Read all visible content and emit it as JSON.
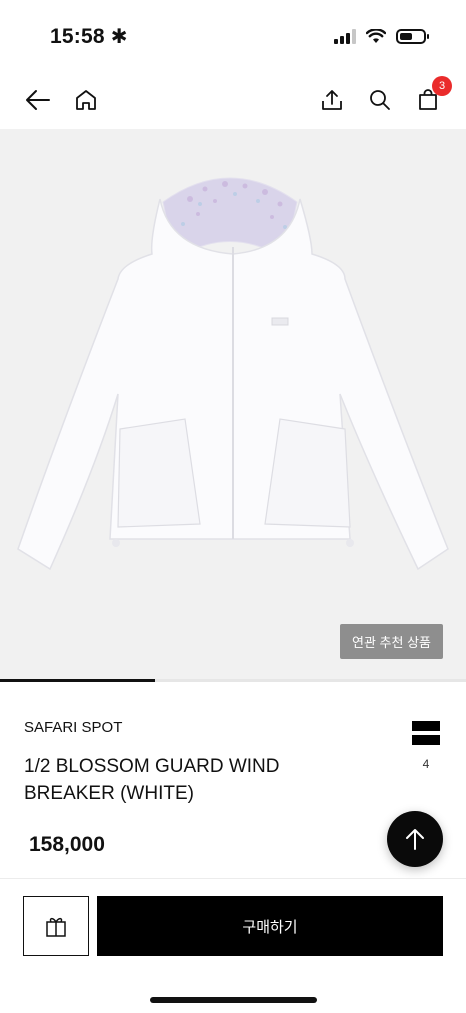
{
  "status_bar": {
    "time": "15:58",
    "time_suffix_icon": "asterisk-icon"
  },
  "nav": {
    "back_icon": "arrow-left-icon",
    "home_icon": "home-icon",
    "share_icon": "share-icon",
    "search_icon": "search-icon",
    "cart_icon": "shopping-bag-icon",
    "cart_count": "3"
  },
  "gallery": {
    "image_subject": "white hooded wind breaker jacket with floral lining",
    "related_button_label": "연관 추천 상품",
    "progress": 0.333
  },
  "product": {
    "brand": "SAFARI SPOT",
    "name": "1/2 BLOSSOM GUARD WIND BREAKER (WHITE)",
    "price": "158,000",
    "wish_count": "4"
  },
  "actions": {
    "buy_label": "구매하기",
    "gift_icon": "gift-icon",
    "scroll_top_icon": "arrow-up-icon"
  },
  "colors": {
    "accent_black": "#000000",
    "badge_red": "#ea2b2b",
    "image_background": "#f1f1f1"
  }
}
